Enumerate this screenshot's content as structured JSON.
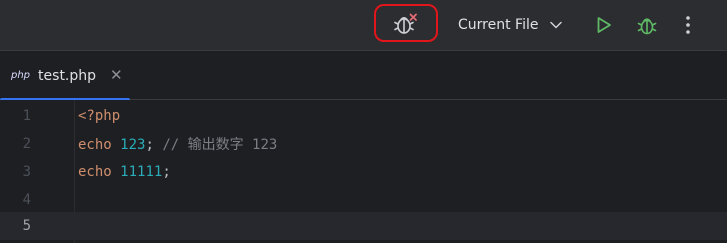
{
  "toolbar": {
    "run_config": "Current File",
    "icons": [
      "debug-stop-icon",
      "chevron-down-icon",
      "run-icon",
      "debug-icon",
      "more-vertical-icon"
    ]
  },
  "tabs": [
    {
      "type_label": "php",
      "name": "test.php",
      "active": true
    }
  ],
  "editor": {
    "current_line": 5,
    "lines": [
      {
        "number": "1",
        "tokens": [
          {
            "kind": "kw",
            "text": "<?php"
          }
        ]
      },
      {
        "number": "2",
        "tokens": [
          {
            "kind": "kw",
            "text": "echo"
          },
          {
            "kind": "plain",
            "text": " "
          },
          {
            "kind": "num",
            "text": "123"
          },
          {
            "kind": "plain",
            "text": "; "
          },
          {
            "kind": "cm",
            "text": "// 输出数字 123"
          }
        ]
      },
      {
        "number": "3",
        "tokens": [
          {
            "kind": "kw",
            "text": "echo"
          },
          {
            "kind": "plain",
            "text": " "
          },
          {
            "kind": "num",
            "text": "11111"
          },
          {
            "kind": "plain",
            "text": ";"
          }
        ]
      },
      {
        "number": "4",
        "tokens": []
      },
      {
        "number": "5",
        "tokens": []
      }
    ]
  },
  "colors": {
    "annotation": "#e0161b",
    "run": "#5fb865",
    "accent": "#3574f0"
  }
}
